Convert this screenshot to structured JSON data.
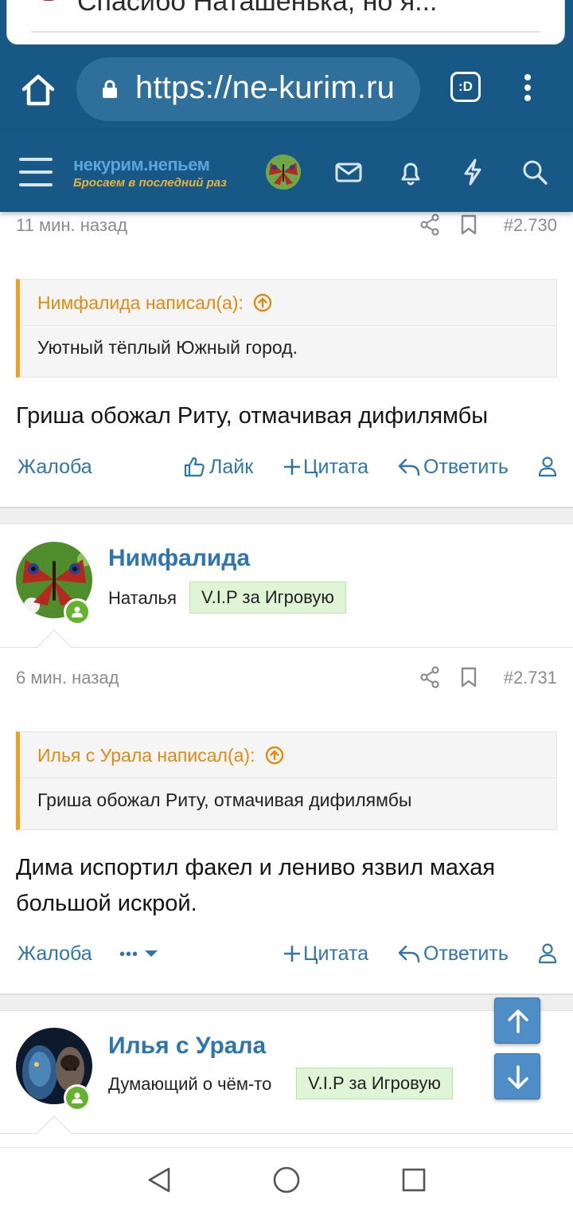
{
  "browser": {
    "tab_title": "Спасибо Наташенька, но я...",
    "url": "https://ne-kurim.ru",
    "tabs_label": ":D"
  },
  "site": {
    "logo_line1": "некурим.непьем",
    "logo_line2": "Бросаем в последний раз"
  },
  "post1": {
    "time": "11 мин. назад",
    "number": "#2.730",
    "quote_author": "Нимфалида написал(а):",
    "quote_text": "Уютный тёплый Южный город.",
    "message": "Гриша обожал Риту, отмачивая дифилямбы",
    "actions": {
      "report": "Жалоба",
      "like": "Лайк",
      "quote": "Цитата",
      "reply": "Ответить"
    }
  },
  "user2": {
    "name": "Нимфалида",
    "title": "Наталья",
    "badge": "V.I.P за Игровую"
  },
  "post2": {
    "time": "6 мин. назад",
    "number": "#2.731",
    "quote_author": "Илья с Урала написал(а):",
    "quote_text": "Гриша обожал Риту, отмачивая дифилямбы",
    "message": "Дима испортил факел и лениво язвил махая большой искрой.",
    "actions": {
      "report": "Жалоба",
      "more": "•••",
      "quote": "Цитата",
      "reply": "Ответить"
    }
  },
  "user3": {
    "name": "Илья с Урала",
    "title": "Думающий о чём-то",
    "badge": "V.I.P за Игровую"
  },
  "colors": {
    "header": "#185886",
    "link": "#2d76ad",
    "quote_accent": "#f0a01e",
    "badge_bg": "#dff5d6",
    "online": "#63b32e"
  }
}
